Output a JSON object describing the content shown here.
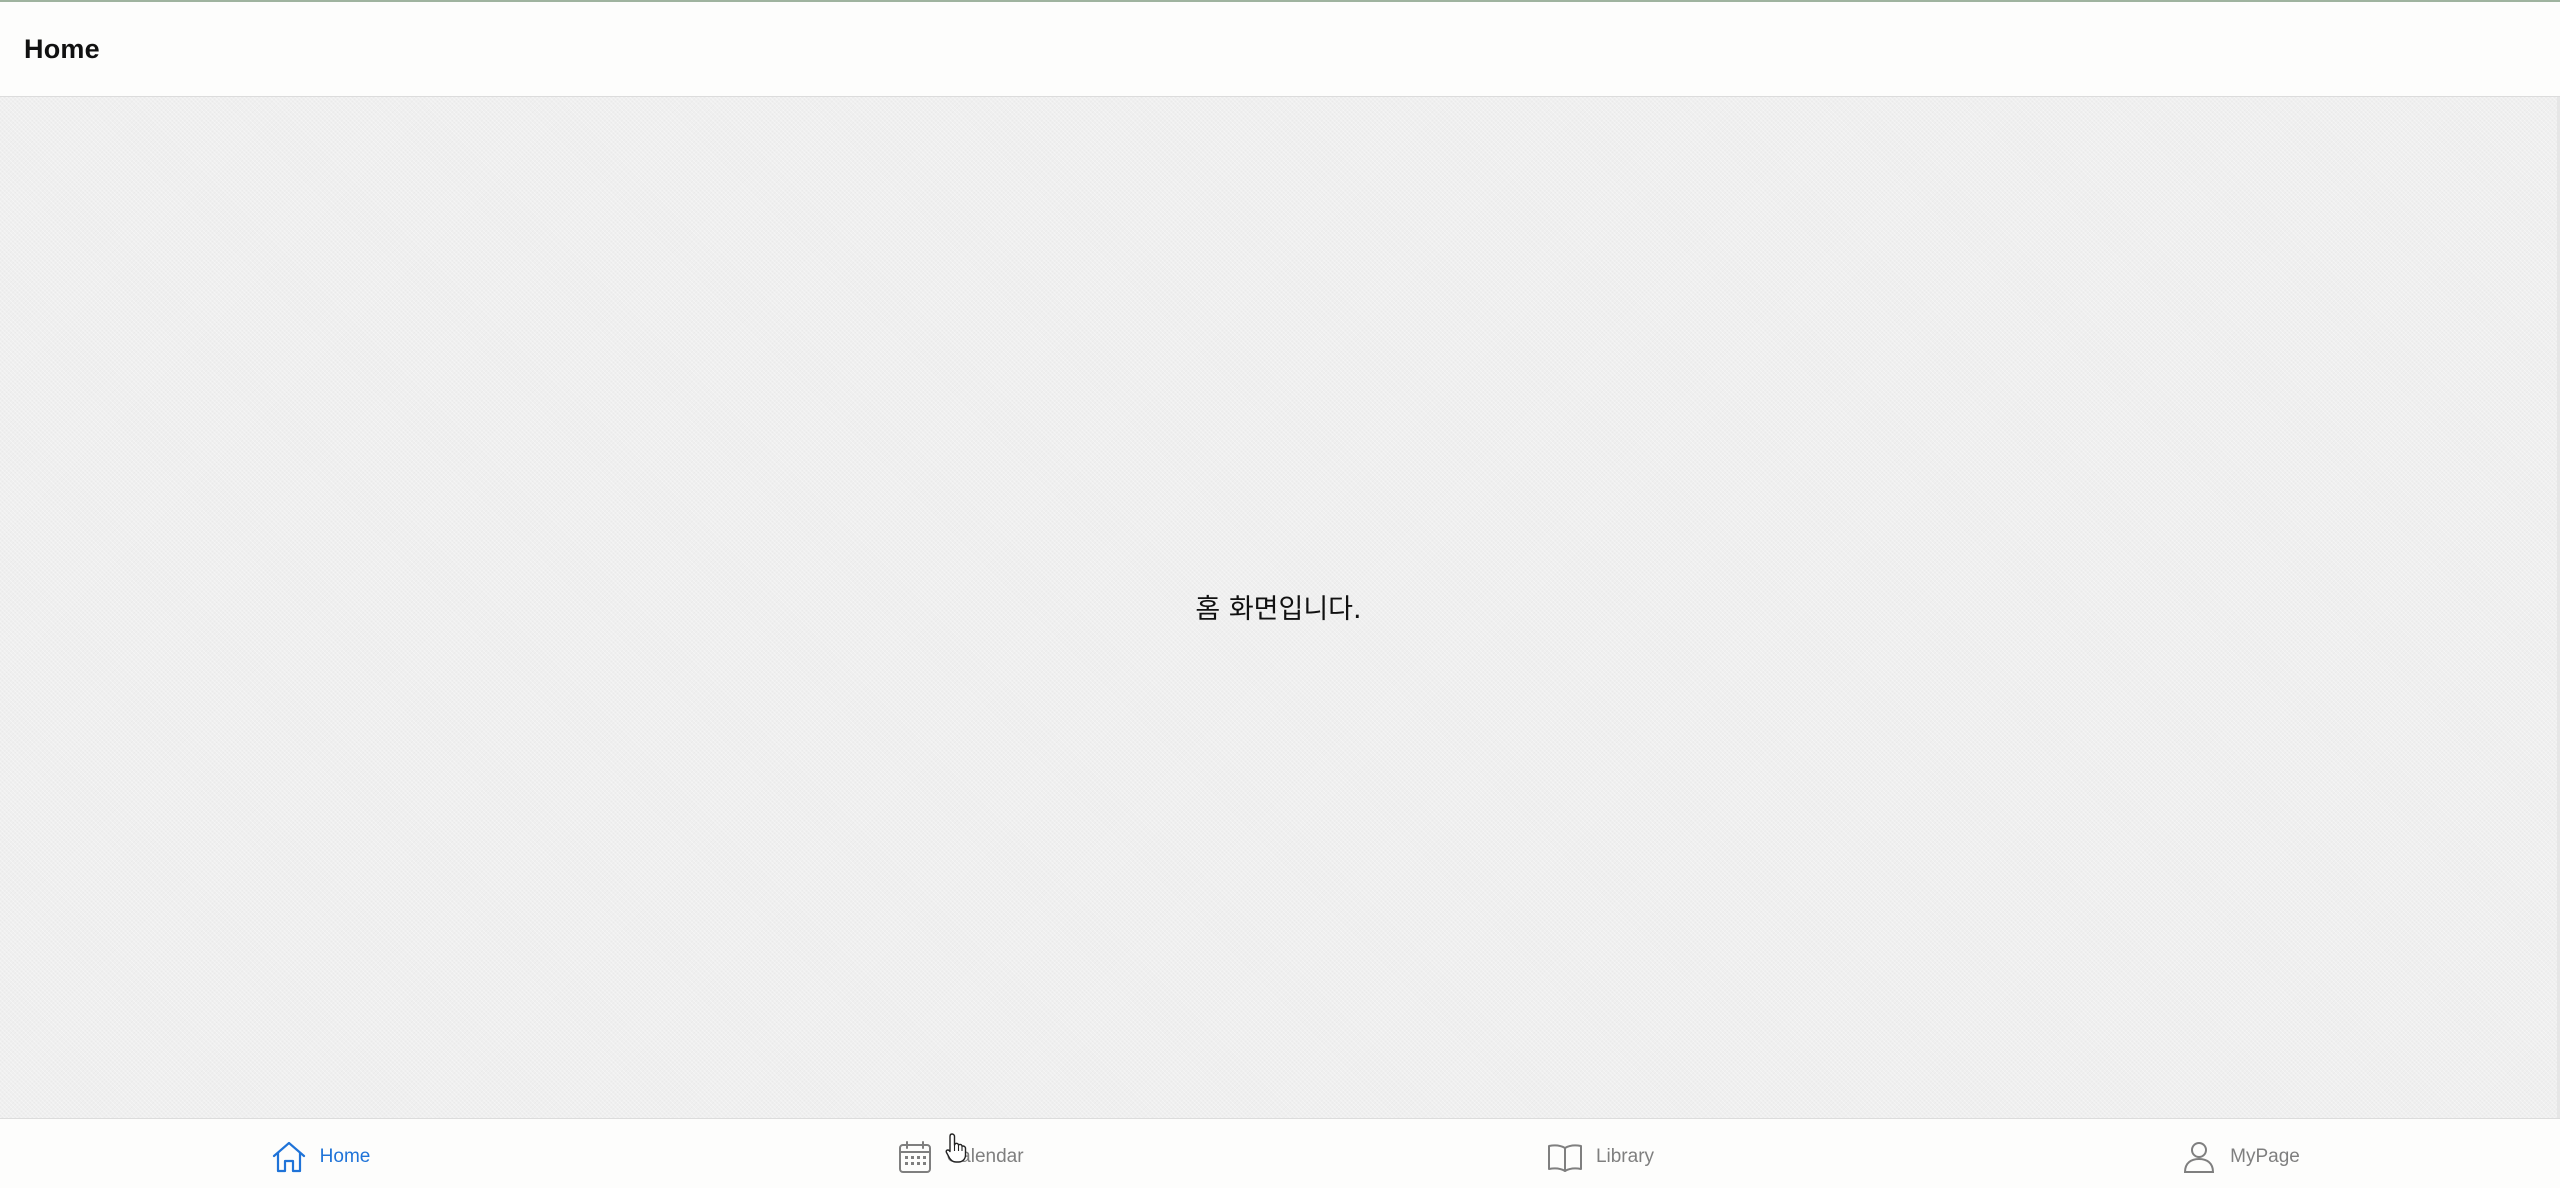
{
  "header": {
    "title": "Home"
  },
  "main": {
    "message": "홈 화면입니다."
  },
  "tabbar": {
    "active_color": "#1f73d8",
    "inactive_color": "#7f7f7f",
    "tabs": [
      {
        "label": "Home",
        "icon": "home-icon",
        "active": true
      },
      {
        "label": "Calendar",
        "icon": "calendar-icon",
        "active": false
      },
      {
        "label": "Library",
        "icon": "book-icon",
        "active": false
      },
      {
        "label": "MyPage",
        "icon": "user-icon",
        "active": false
      }
    ]
  }
}
